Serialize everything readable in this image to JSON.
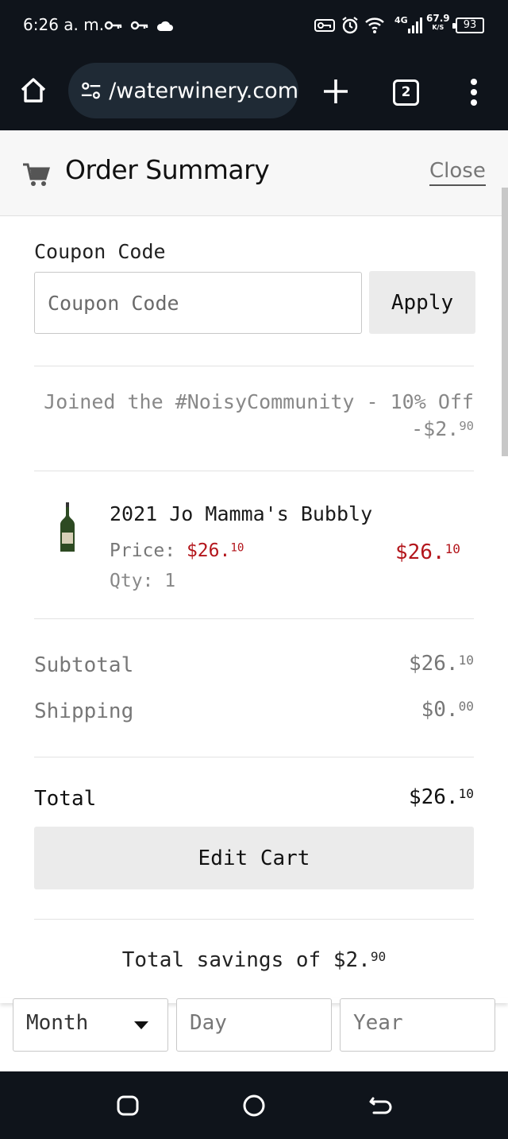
{
  "status_bar": {
    "time": "6:26 a. m.",
    "network": "4G",
    "speed_value": "67.9",
    "speed_unit": "K/S",
    "battery": "93"
  },
  "browser": {
    "url": "/waterwinery.com",
    "tab_count": "2"
  },
  "order_summary": {
    "title": "Order Summary",
    "close_label": "Close"
  },
  "coupon": {
    "label": "Coupon Code",
    "placeholder": "Coupon Code",
    "apply_label": "Apply"
  },
  "discount": {
    "label": "Joined the #NoisyCommunity - 10% Off",
    "amount_main": "-$2.",
    "amount_cents": "90"
  },
  "item": {
    "name": "2021 Jo Mamma's Bubbly",
    "price_label": "Price:",
    "price_main": "$26.",
    "price_cents": "10",
    "total_main": "$26.",
    "total_cents": "10",
    "qty_label": "Qty: 1"
  },
  "totals": {
    "subtotal_label": "Subtotal",
    "subtotal_main": "$26.",
    "subtotal_cents": "10",
    "shipping_label": "Shipping",
    "shipping_main": "$0.",
    "shipping_cents": "00",
    "total_label": "Total",
    "total_main": "$26.",
    "total_cents": "10"
  },
  "edit_cart_label": "Edit Cart",
  "savings": {
    "text": "Total savings of ",
    "amount_main": "$2.",
    "amount_cents": "90"
  },
  "date_fields": {
    "month": "Month",
    "day": "Day",
    "year": "Year"
  },
  "colors": {
    "price_red": "#b3151b",
    "bar_dark": "#0f141b"
  },
  "icons": [
    "home-icon",
    "tune-icon",
    "plus-icon",
    "more-vert-icon",
    "cart-icon",
    "wine-bottle-icon",
    "key-icon",
    "cloud-icon",
    "alarm-icon",
    "wifi-icon",
    "signal-icon"
  ]
}
